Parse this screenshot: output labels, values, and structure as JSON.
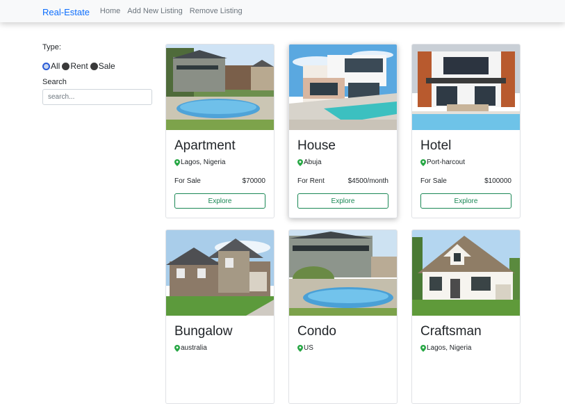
{
  "navbar": {
    "brand": "Real-Estate",
    "links": [
      "Home",
      "Add New Listing",
      "Remove Listing"
    ]
  },
  "sidebar": {
    "type_label": "Type:",
    "type_options": [
      "All",
      "Rent",
      "Sale"
    ],
    "selected_type": "All",
    "search_label": "Search",
    "search_placeholder": "search..."
  },
  "listings": [
    {
      "title": "Apartment",
      "location": "Lagos, Nigeria",
      "status": "For Sale",
      "price": "$70000",
      "button": "Explore"
    },
    {
      "title": "House",
      "location": "Abuja",
      "status": "For Rent",
      "price": "$4500/month",
      "button": "Explore"
    },
    {
      "title": "Hotel",
      "location": "Port-harcout",
      "status": "For Sale",
      "price": "$100000",
      "button": "Explore"
    },
    {
      "title": "Bungalow",
      "location": "australia",
      "status": "",
      "price": "",
      "button": ""
    },
    {
      "title": "Condo",
      "location": "US",
      "status": "",
      "price": "",
      "button": ""
    },
    {
      "title": "Craftsman",
      "location": "Lagos, Nigeria",
      "status": "",
      "price": "",
      "button": ""
    }
  ],
  "colors": {
    "brand": "#0d6efd",
    "success": "#198754",
    "pin": "#28a745"
  }
}
